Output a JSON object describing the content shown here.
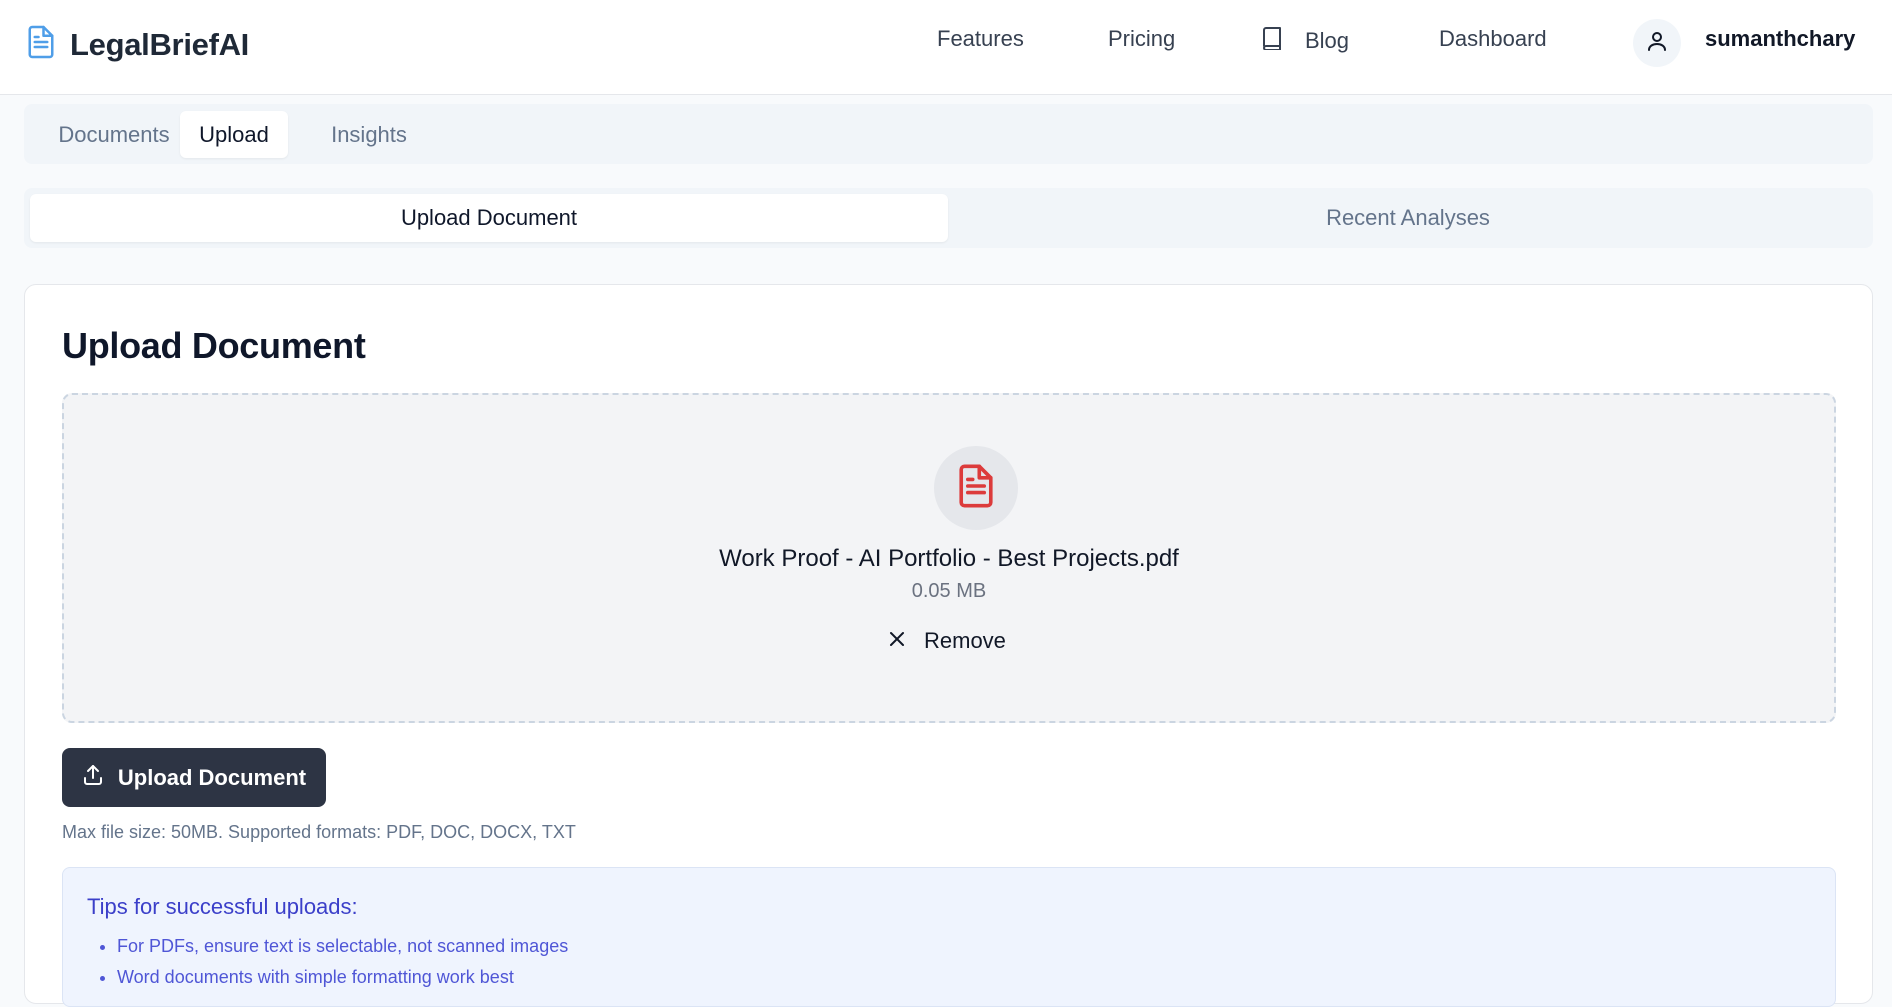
{
  "brand": {
    "name": "LegalBriefAI",
    "icon": "document-icon",
    "accent": "#4f9ee8"
  },
  "nav": {
    "features": "Features",
    "pricing": "Pricing",
    "blog": "Blog",
    "dashboard": "Dashboard",
    "username": "sumanthchary"
  },
  "main_tabs": [
    {
      "label": "Documents",
      "active": false
    },
    {
      "label": "Upload",
      "active": true
    },
    {
      "label": "Insights",
      "active": false
    }
  ],
  "sub_tabs": [
    {
      "label": "Upload Document",
      "active": true
    },
    {
      "label": "Recent Analyses",
      "active": false
    }
  ],
  "upload": {
    "title": "Upload Document",
    "file_name": "Work Proof - AI Portfolio - Best Projects.pdf",
    "file_size": "0.05 MB",
    "remove_label": "Remove",
    "button_label": "Upload Document",
    "hint": "Max file size: 50MB. Supported formats: PDF, DOC, DOCX, TXT",
    "file_icon_color": "#dc3b3b"
  },
  "tips": {
    "title": "Tips for successful uploads:",
    "items": [
      "For PDFs, ensure text is selectable, not scanned images",
      "Word documents with simple formatting work best"
    ]
  },
  "colors": {
    "button_bg": "#2d3444",
    "tips_text": "#3b3fc9"
  }
}
